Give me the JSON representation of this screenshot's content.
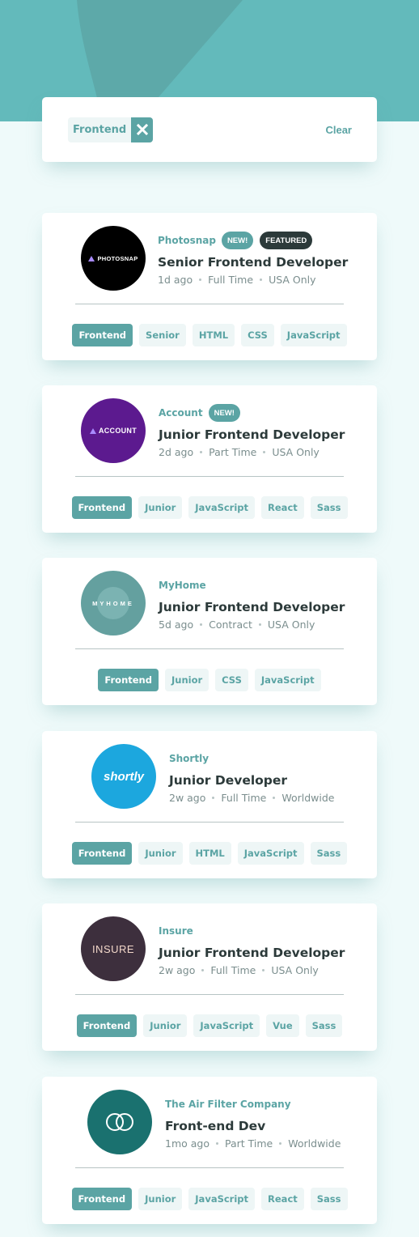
{
  "colors": {
    "primary": "#5ba4a4",
    "header_bg": "#63babb",
    "page_bg": "#effafa",
    "dark": "#2c3a3a",
    "gray": "#7b8e8e",
    "tag_bg": "#eef6f6"
  },
  "filters": {
    "active": [
      "Frontend"
    ],
    "remove_icon": "close-icon",
    "clear_label": "Clear"
  },
  "jobs": [
    {
      "company": "Photosnap",
      "new_label": "NEW!",
      "featured_label": "FEATURED",
      "position": "Senior Frontend Developer",
      "posted": "1d ago",
      "contract": "Full Time",
      "location": "USA Only",
      "logo": {
        "text": "PHOTOSNAP",
        "bg": "#000000",
        "icon": "triangle-icon"
      },
      "tags": [
        "Frontend",
        "Senior",
        "HTML",
        "CSS",
        "JavaScript"
      ]
    },
    {
      "company": "Account",
      "new_label": "NEW!",
      "position": "Junior Frontend Developer",
      "posted": "2d ago",
      "contract": "Part Time",
      "location": "USA Only",
      "logo": {
        "text": "ACCOUNT",
        "bg": "#5c1a8f",
        "icon": "triangle-icon"
      },
      "tags": [
        "Frontend",
        "Junior",
        "JavaScript",
        "React",
        "Sass"
      ]
    },
    {
      "company": "MyHome",
      "position": "Junior Frontend Developer",
      "posted": "5d ago",
      "contract": "Contract",
      "location": "USA Only",
      "logo": {
        "text": "MYHOME",
        "bg": "#64a09f"
      },
      "tags": [
        "Frontend",
        "Junior",
        "CSS",
        "JavaScript"
      ]
    },
    {
      "company": "Shortly",
      "position": "Junior Developer",
      "posted": "2w ago",
      "contract": "Full Time",
      "location": "Worldwide",
      "logo": {
        "text": "shortly",
        "bg": "#1ca7de"
      },
      "tags": [
        "Frontend",
        "Junior",
        "HTML",
        "JavaScript",
        "Sass"
      ]
    },
    {
      "company": "Insure",
      "position": "Junior Frontend Developer",
      "posted": "2w ago",
      "contract": "Full Time",
      "location": "USA Only",
      "logo": {
        "text": "INSURE",
        "bg": "#3d2f3d"
      },
      "tags": [
        "Frontend",
        "Junior",
        "JavaScript",
        "Vue",
        "Sass"
      ]
    },
    {
      "company": "The Air Filter Company",
      "position": "Front-end Dev",
      "posted": "1mo ago",
      "contract": "Part Time",
      "location": "Worldwide",
      "logo": {
        "bg": "#1a716f",
        "icon": "rings-icon"
      },
      "tags": [
        "Frontend",
        "Junior",
        "JavaScript",
        "React",
        "Sass"
      ]
    }
  ]
}
